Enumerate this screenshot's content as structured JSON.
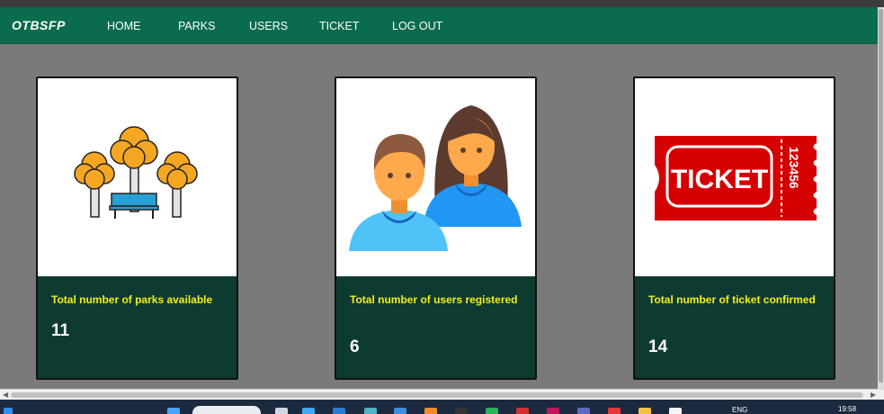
{
  "navbar": {
    "brand": "OTBSFP",
    "links": [
      {
        "label": "HOME"
      },
      {
        "label": "PARKS"
      },
      {
        "label": "USERS"
      },
      {
        "label": "TICKET"
      },
      {
        "label": "LOG OUT"
      }
    ]
  },
  "cards": [
    {
      "label": "Total number of parks available",
      "value": "11",
      "icon": "park-icon"
    },
    {
      "label": "Total number of users registered",
      "value": "6",
      "icon": "users-icon"
    },
    {
      "label": "Total number of ticket confirmed",
      "value": "14",
      "icon": "ticket-icon"
    }
  ],
  "ticket_graphic": {
    "word": "TICKET",
    "number": "123456"
  },
  "taskbar": {
    "lang": "ENG",
    "time": "19:58"
  },
  "colors": {
    "navbar": "#0b6b4f",
    "card_footer": "#0e3b31",
    "card_label": "#f2ef1a",
    "page_background": "#7a7a7a"
  }
}
